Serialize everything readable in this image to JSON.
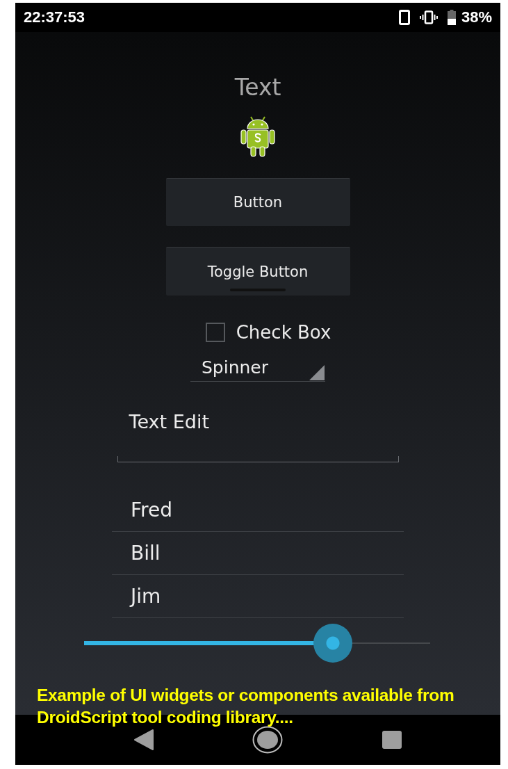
{
  "status_bar": {
    "time": "22:37:53",
    "battery": "38%"
  },
  "title": "Text",
  "button": {
    "label": "Button"
  },
  "toggle_button": {
    "label": "Toggle Button",
    "checked": false
  },
  "check_box": {
    "label": "Check Box",
    "checked": false
  },
  "spinner": {
    "value": "Spinner"
  },
  "text_edit": {
    "value": "Text Edit"
  },
  "list": [
    {
      "label": "Fred"
    },
    {
      "label": "Bill"
    },
    {
      "label": "Jim"
    }
  ],
  "slider": {
    "level": 0.72
  },
  "caption": "Example of UI widgets or components available from DroidScript tool coding library...."
}
